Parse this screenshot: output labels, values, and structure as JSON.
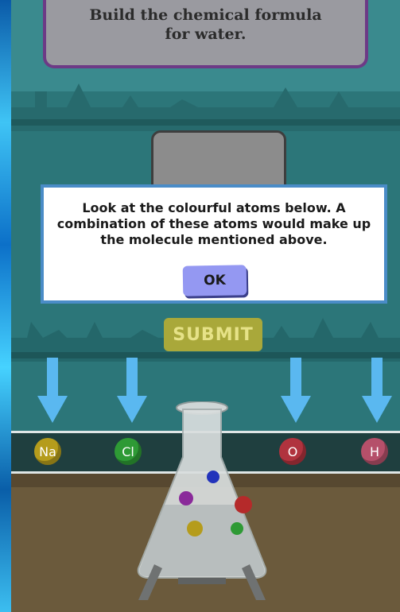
{
  "prompt": {
    "text": "Build the chemical formula for water."
  },
  "modal": {
    "message": "Look at the colourful atoms below. A combination of these atoms would make up the molecule mentioned above.",
    "ok_label": "OK"
  },
  "submit_label": "SUBMIT",
  "atoms": [
    {
      "symbol": "Na",
      "color": "#b59c1c"
    },
    {
      "symbol": "Cl",
      "color": "#2e9a35"
    },
    {
      "symbol": "O",
      "color": "#b0333e"
    },
    {
      "symbol": "H",
      "color": "#b5506a"
    }
  ],
  "flask_contents": [
    {
      "color": "#2233bb"
    },
    {
      "color": "#8a2a9a"
    },
    {
      "color": "#b52a2a"
    },
    {
      "color": "#b59c1c"
    },
    {
      "color": "#2e9a35"
    }
  ],
  "colors": {
    "modal_border": "#4a8cc7",
    "ok_button": "#9498f2",
    "prompt_border": "#6d3a86",
    "arrow": "#5ab8f0"
  }
}
